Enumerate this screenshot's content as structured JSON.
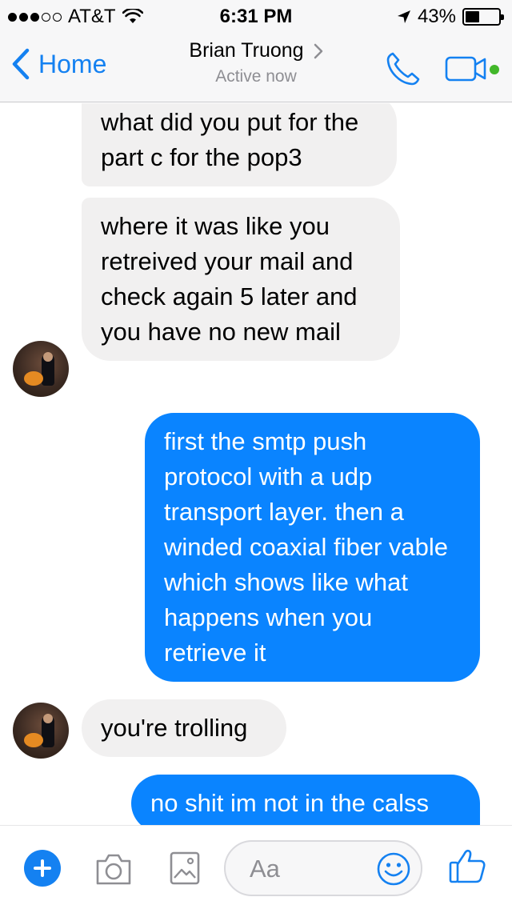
{
  "status_bar": {
    "carrier": "AT&T",
    "time": "6:31 PM",
    "battery": "43%",
    "signal_full": 3,
    "signal_total": 5
  },
  "nav": {
    "back_label": "Home",
    "contact_name": "Brian Truong",
    "contact_status": "Active now"
  },
  "colors": {
    "accent": "#1481f1",
    "outgoing_bubble": "#0a84ff",
    "incoming_bubble": "#f1f0f0",
    "online": "#42b72a"
  },
  "messages": [
    {
      "direction": "incoming",
      "text": "what did you put for the part c for the pop3"
    },
    {
      "direction": "incoming",
      "text": "where it was like you retreived your mail and check again 5 later and you have no new mail"
    },
    {
      "direction": "outgoing",
      "text": "first the smtp push protocol with a udp transport layer. then a winded coaxial fiber vable which shows like what happens when you retrieve it"
    },
    {
      "direction": "incoming",
      "text": "you're trolling"
    },
    {
      "direction": "outgoing",
      "text": "no shit im not in the calss"
    }
  ],
  "composer": {
    "placeholder": "Aa",
    "icons": [
      "plus-icon",
      "camera-icon",
      "image-icon",
      "emoji-icon",
      "thumbs-up-icon"
    ]
  }
}
